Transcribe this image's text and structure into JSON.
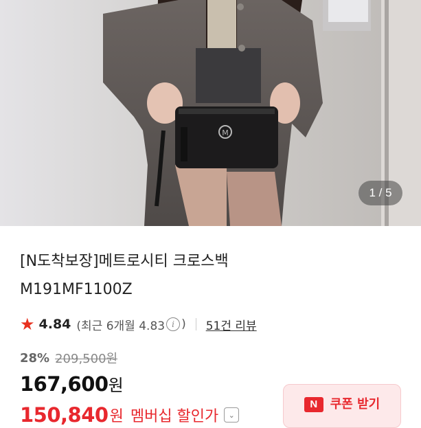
{
  "gallery": {
    "counter": "1 / 5"
  },
  "product": {
    "title_line1": "[N도착보장]메트로시티 크로스백",
    "title_line2": "M191MF1100Z"
  },
  "rating": {
    "star_icon": "star-icon",
    "score": "4.84",
    "recent_open": "(최근 6개월 4.83",
    "info_icon": "i",
    "recent_close": ")",
    "review_link": "51건 리뷰"
  },
  "pricing": {
    "discount": "28%",
    "original_price": "209,500원",
    "price": "167,600",
    "price_unit": "원",
    "member_price": "150,840",
    "member_unit": "원",
    "member_label": "멤버십 할인가",
    "member_chevron": "⌄"
  },
  "coupon": {
    "badge": "N",
    "label": "쿠폰 받기"
  },
  "colors": {
    "accent": "#e8282e",
    "star": "#e8311f",
    "coupon_bg": "#fde9ea"
  }
}
